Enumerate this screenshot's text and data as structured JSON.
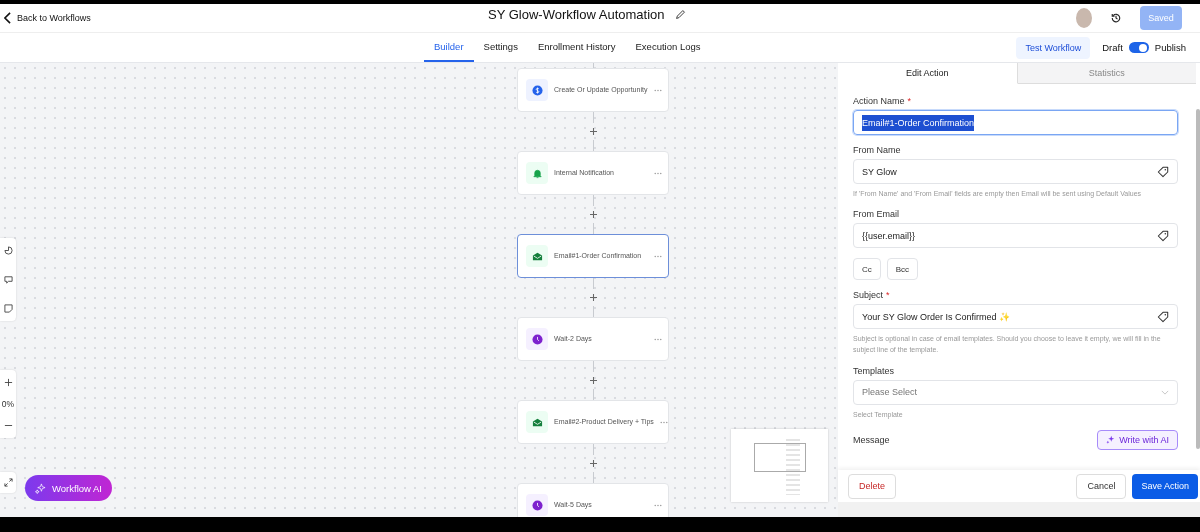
{
  "header": {
    "back_link": "Back to Workflows",
    "title": "SY Glow-Workflow Automation",
    "saved_button": {
      "label": "Saved",
      "disabled": true
    }
  },
  "nav": {
    "tabs": [
      {
        "label": "Builder",
        "selected": true
      },
      {
        "label": "Settings",
        "selected": false
      },
      {
        "label": "Enrollment History",
        "selected": false
      },
      {
        "label": "Execution Logs",
        "selected": false
      }
    ],
    "test_button": "Test Workflow",
    "toggle": {
      "off_label": "Draft",
      "on_label": "Publish",
      "on": true
    }
  },
  "canvas": {
    "zoom_level": "0%",
    "ai_button": "Workflow AI",
    "nodes": [
      {
        "kind": "opportunity",
        "label": "Create Or Update Opportunity",
        "selected": false
      },
      {
        "kind": "notification",
        "label": "Internal Notification",
        "selected": false
      },
      {
        "kind": "email",
        "label": "Email#1-Order Confirmation",
        "selected": true
      },
      {
        "kind": "wait",
        "label": "Wait-2 Days",
        "selected": false
      },
      {
        "kind": "email",
        "label": "Email#2-Product Delivery + Tips",
        "selected": false
      },
      {
        "kind": "wait",
        "label": "Wait-5 Days",
        "selected": false
      }
    ]
  },
  "panel": {
    "tabs": [
      {
        "label": "Edit Action",
        "selected": true
      },
      {
        "label": "Statistics",
        "selected": false
      }
    ],
    "fields": [
      {
        "kind": "input",
        "label": "Action Name",
        "required_mark": "*",
        "value": "Email#1-Order Confirmation",
        "value_selected": true,
        "tag": false
      },
      {
        "kind": "input",
        "label": "From Name",
        "value": "SY Glow",
        "value_selected": false,
        "tag": true,
        "hint": "If 'From Name' and 'From Email' fields are empty then Email will be sent using Default Values"
      },
      {
        "kind": "input",
        "label": "From Email",
        "value": "{{user.email}}",
        "value_selected": false,
        "tag": true
      },
      {
        "kind": "chips",
        "chips": [
          "Cc",
          "Bcc"
        ]
      },
      {
        "kind": "input",
        "label": "Subject",
        "required_mark": "*",
        "value": "Your SY Glow Order Is Confirmed ✨",
        "value_selected": false,
        "tag": true,
        "hint": "Subject is optional in case of email templates. Should you choose to leave it empty, we will fill in the subject line of the template."
      },
      {
        "kind": "select",
        "label": "Templates",
        "placeholder": "Please Select",
        "hint": "Select Template"
      },
      {
        "kind": "message",
        "label": "Message",
        "ai_button": "Write with AI"
      }
    ],
    "footer": {
      "delete": "Delete",
      "cancel": "Cancel",
      "save": "Save Action"
    }
  }
}
